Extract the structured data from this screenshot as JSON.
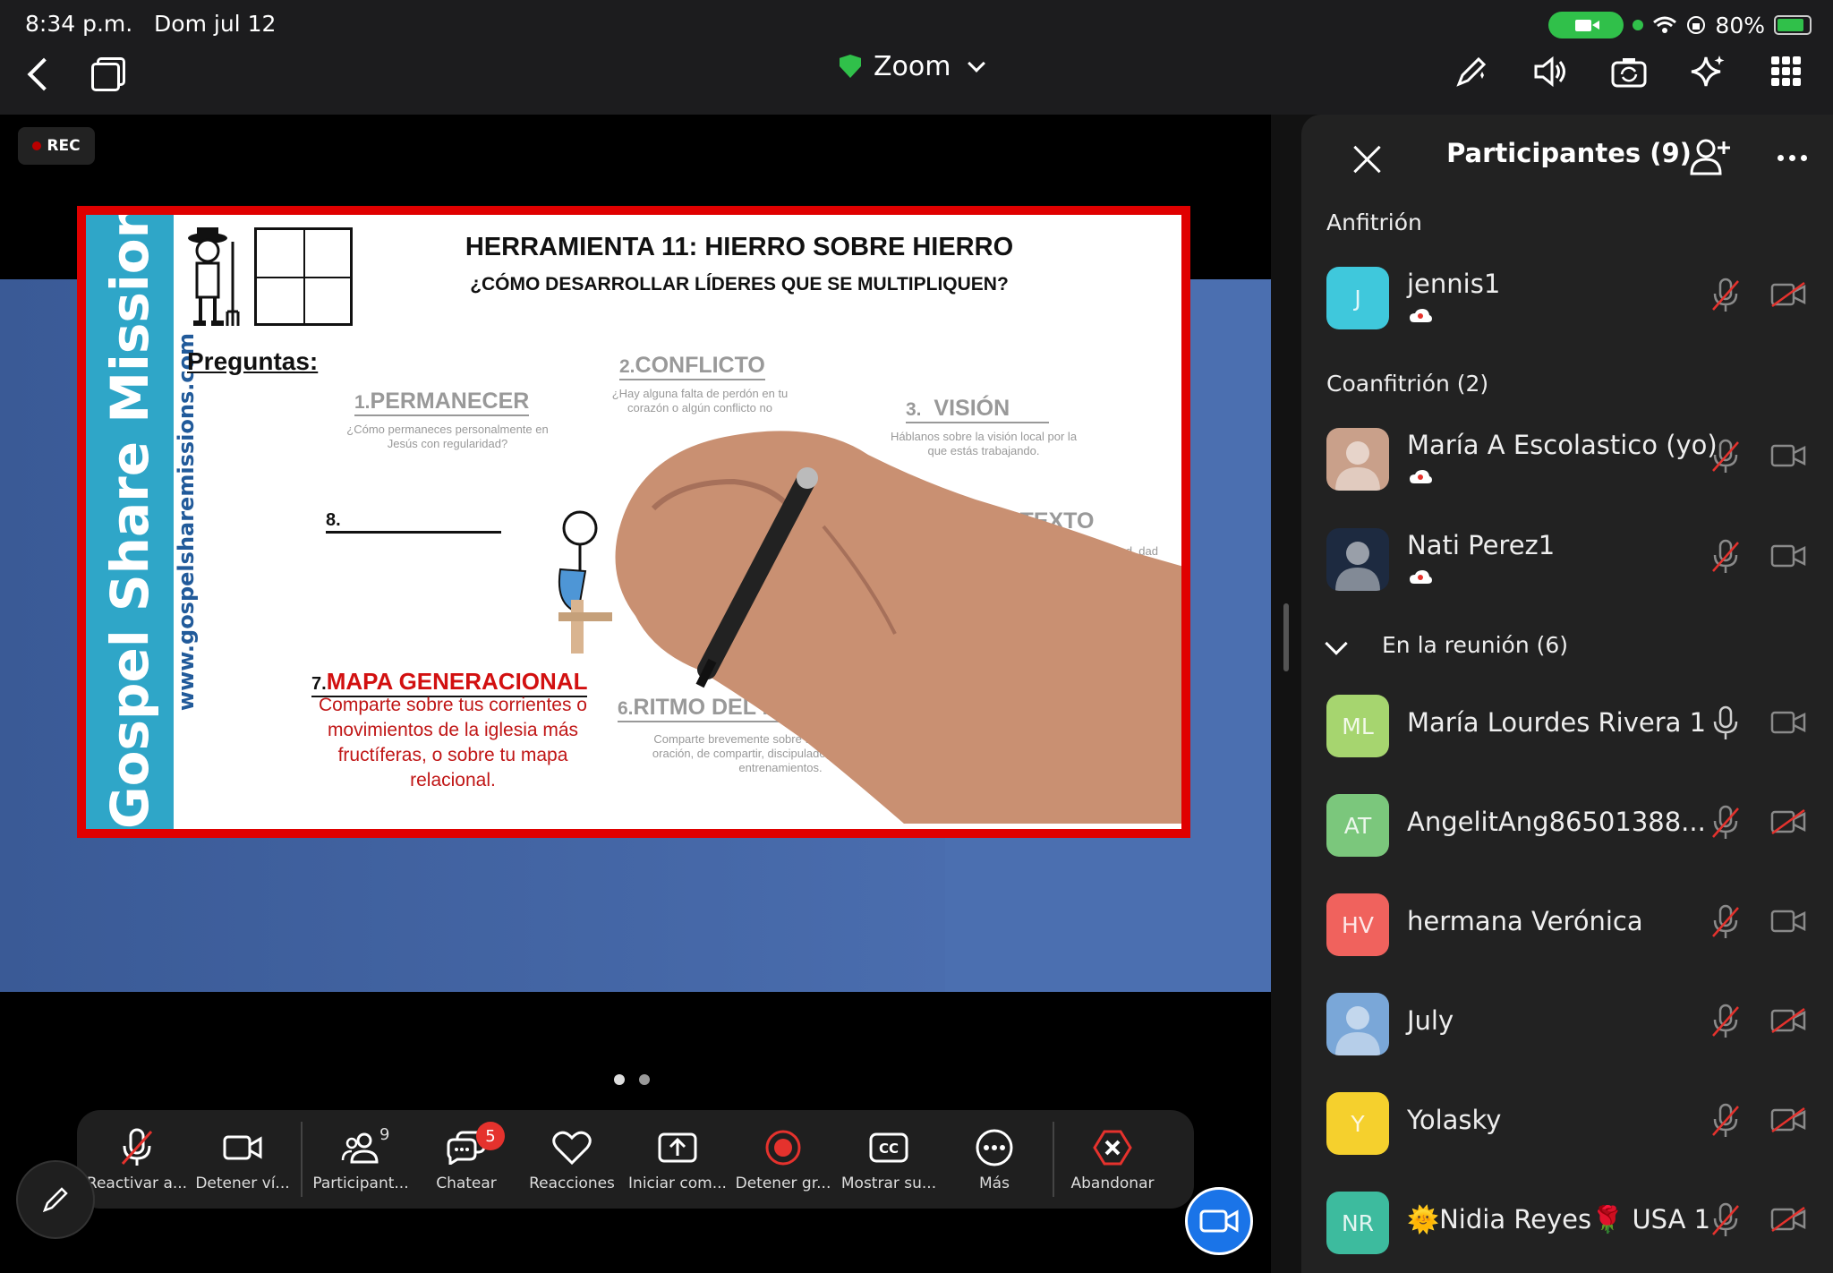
{
  "status": {
    "time": "8:34 p.m.",
    "date": "Dom jul 12",
    "battery": "80%"
  },
  "nav": {
    "title": "Zoom"
  },
  "rec_label": "REC",
  "slide": {
    "brand": "Gospel Share Missions",
    "url": "www.gospelsharemissions.com",
    "title": "HERRAMIENTA 11: HIERRO SOBRE HIERRO",
    "subtitle": "¿CÓMO DESARROLLAR LÍDERES QUE SE MULTIPLIQUEN?",
    "preguntas": "Preguntas:",
    "items": [
      {
        "num": "1.",
        "head": "PERMANECER",
        "desc": "¿Cómo permaneces personalmente en Jesús con regularidad?"
      },
      {
        "num": "2.",
        "head": "CONFLICTO",
        "desc": "¿Hay alguna falta de perdón en tu corazón o algún conflicto no"
      },
      {
        "num": "3.",
        "head": "VISIÓN",
        "desc": "Háblanos sobre la visión local por la que estás trabajando."
      },
      {
        "num": "",
        "head": "CONTEXTO",
        "desc": "cal, ciudad, dad etc."
      },
      {
        "num": "6.",
        "head": "RITMO DEL MINISTERIO",
        "desc": "Comparte brevemente sobre tu ritmo semanal de oración, de compartir, discipulado, familia, iglesia, entrenamientos."
      }
    ],
    "eight": "8.",
    "seven_num": "7.",
    "seven_head": "MAPA GENERACIONAL",
    "seven_desc": "Comparte sobre tus corrientes o movimientos de la iglesia más fructíferas, o sobre tu mapa relacional."
  },
  "toolbar": {
    "buttons": [
      {
        "label": "Reactivar a...",
        "icon": "mic-muted-icon"
      },
      {
        "label": "Detener ví...",
        "icon": "video-icon"
      },
      {
        "label": "Participant...",
        "icon": "participants-icon",
        "count": "9"
      },
      {
        "label": "Chatear",
        "icon": "chat-icon",
        "badge": "5"
      },
      {
        "label": "Reacciones",
        "icon": "heart-icon"
      },
      {
        "label": "Iniciar com...",
        "icon": "share-screen-icon"
      },
      {
        "label": "Detener gr...",
        "icon": "record-icon"
      },
      {
        "label": "Mostrar su...",
        "icon": "cc-icon"
      },
      {
        "label": "Más",
        "icon": "more-icon"
      },
      {
        "label": "Abandonar",
        "icon": "leave-icon"
      }
    ]
  },
  "panel": {
    "title": "Participantes (9)",
    "host_section": "Anfitrión",
    "cohost_section": "Coanfitrión (2)",
    "meeting_section": "En la reunión (6)",
    "host": [
      {
        "initials": "J",
        "name": "jennis1",
        "color": "#3fc8dc",
        "mic": "muted",
        "video": "off"
      }
    ],
    "cohosts": [
      {
        "initials": "",
        "name": "María A Escolastico (yo)",
        "color": "#c9a08a",
        "mic": "muted",
        "video": "on"
      },
      {
        "initials": "",
        "name": "Nati Perez1",
        "color": "#1d2a40",
        "mic": "muted",
        "video": "on"
      }
    ],
    "members": [
      {
        "initials": "ML",
        "name": "María Lourdes Rivera 1",
        "color": "#a6d56f",
        "mic": "on",
        "video": "on"
      },
      {
        "initials": "AT",
        "name": "AngelitAng86501388...",
        "color": "#7bc77c",
        "mic": "muted",
        "video": "off"
      },
      {
        "initials": "HV",
        "name": "hermana Verónica",
        "color": "#f0625d",
        "mic": "muted",
        "video": "on"
      },
      {
        "initials": "",
        "name": "July",
        "color": "#7aa7d8",
        "mic": "muted",
        "video": "off"
      },
      {
        "initials": "Y",
        "name": "Yolasky",
        "color": "#f5d02d",
        "mic": "muted",
        "video": "off"
      },
      {
        "initials": "NR",
        "name": "🌞Nidia Reyes🌹 USA 1",
        "color": "#3dbb9e",
        "mic": "muted",
        "video": "off"
      }
    ]
  }
}
